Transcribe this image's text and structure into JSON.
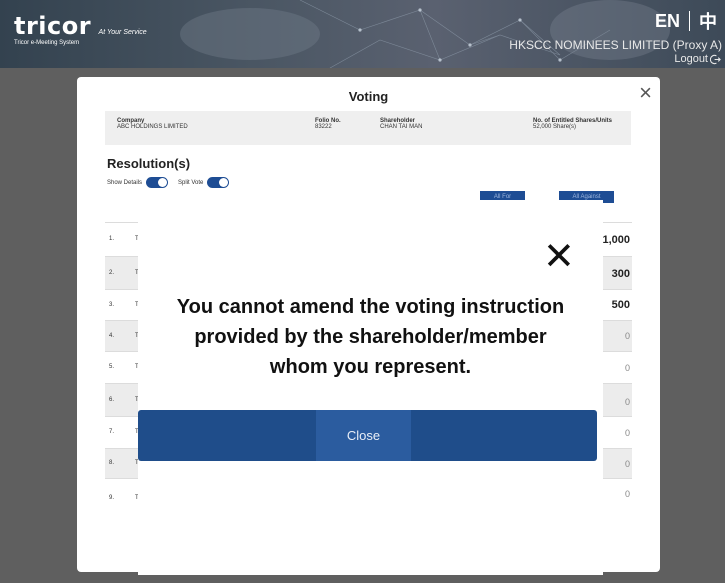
{
  "header": {
    "logo_text": "tricor",
    "logo_tagline": "At Your Service",
    "system_name": "Tricor e-Meeting System",
    "lang_en": "EN",
    "lang_zh": "中",
    "account_name": "HKSCC NOMINEES LIMITED (Proxy A)",
    "logout_label": "Logout"
  },
  "voting_modal": {
    "title": "Voting",
    "close_glyph": "×",
    "info": {
      "company_label": "Company",
      "company_value": "ABC HOLDINGS LIMITED",
      "folio_label": "Folio No.",
      "folio_value": "83222",
      "shareholder_label": "Shareholder",
      "shareholder_value": "CHAN TAI MAN",
      "shares_label": "No. of Entitled Shares/Units",
      "shares_value": "52,000 Share(s)"
    },
    "resolutions_title": "Resolution(s)",
    "show_details_label": "Show Details",
    "split_vote_label": "Split Vote",
    "all_for_label": "All For",
    "all_against_label": "All Against",
    "rows": [
      {
        "num": "1.",
        "text": "T",
        "value": "1,000"
      },
      {
        "num": "2.",
        "text": "T",
        "value": "300"
      },
      {
        "num": "3.",
        "text": "T",
        "value": "500"
      },
      {
        "num": "4.",
        "text": "T",
        "value": "0"
      },
      {
        "num": "5.",
        "text": "T",
        "value": "0"
      },
      {
        "num": "6.",
        "text": "T",
        "value": "0"
      },
      {
        "num": "7.",
        "text": "T",
        "value": "0"
      },
      {
        "num": "8.",
        "text": "T",
        "value": "0"
      },
      {
        "num": "9.",
        "text": "T",
        "value": "0"
      }
    ]
  },
  "alert": {
    "close_glyph": "✕",
    "message_line1": "You cannot amend the voting instruction",
    "message_line2": "provided by the shareholder/member",
    "message_line3": "whom you represent.",
    "close_button_label": "Close"
  }
}
